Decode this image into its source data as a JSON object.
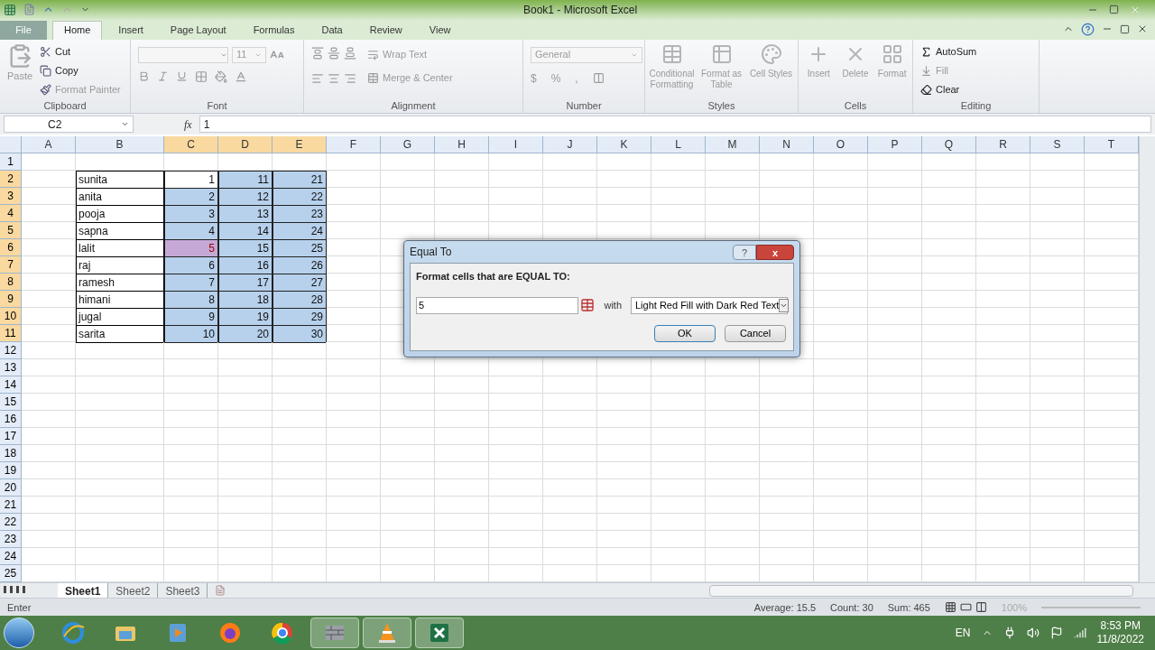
{
  "window": {
    "title": "Book1  -  Microsoft Excel"
  },
  "ribbon_tabs": [
    {
      "label": "File",
      "selected": false,
      "kind": "file"
    },
    {
      "label": "Home",
      "selected": true,
      "kind": "tab"
    },
    {
      "label": "Insert",
      "selected": false,
      "kind": "tab"
    },
    {
      "label": "Page Layout",
      "selected": false,
      "kind": "tab"
    },
    {
      "label": "Formulas",
      "selected": false,
      "kind": "tab"
    },
    {
      "label": "Data",
      "selected": false,
      "kind": "tab"
    },
    {
      "label": "Review",
      "selected": false,
      "kind": "tab"
    },
    {
      "label": "View",
      "selected": false,
      "kind": "tab"
    }
  ],
  "ribbon_groups": [
    {
      "kind": "clipboard",
      "label": "Clipboard",
      "items": [
        {
          "label": "Paste",
          "disabled": true
        },
        {
          "label": "Cut",
          "disabled": false
        },
        {
          "label": "Copy",
          "disabled": false
        },
        {
          "label": "Format Painter",
          "disabled": true
        }
      ]
    },
    {
      "kind": "font",
      "label": "Font",
      "font_size": "11"
    },
    {
      "kind": "alignment",
      "label": "Alignment",
      "items": [
        {
          "label": "Wrap Text",
          "disabled": true
        },
        {
          "label": "Merge & Center",
          "disabled": true
        }
      ]
    },
    {
      "kind": "number",
      "label": "Number",
      "format": "General",
      "symbols": [
        "$",
        "%",
        ","
      ]
    },
    {
      "kind": "styles",
      "label": "Styles",
      "items": [
        {
          "label": "Conditional Formatting",
          "disabled": true
        },
        {
          "label": "Format as Table",
          "disabled": true
        },
        {
          "label": "Cell Styles",
          "disabled": true
        }
      ]
    },
    {
      "kind": "cells",
      "label": "Cells",
      "items": [
        {
          "label": "Insert",
          "disabled": true
        },
        {
          "label": "Delete",
          "disabled": true
        },
        {
          "label": "Format",
          "disabled": true
        }
      ]
    },
    {
      "kind": "editing",
      "label": "Editing",
      "items": [
        {
          "label": "AutoSum",
          "disabled": false
        },
        {
          "label": "Fill",
          "disabled": true
        },
        {
          "label": "Clear",
          "disabled": false
        }
      ]
    }
  ],
  "formula_bar": {
    "name_box": "C2",
    "fx": "fx",
    "formula": "1"
  },
  "columns": [
    {
      "label": "A",
      "selected": false
    },
    {
      "label": "B",
      "selected": false
    },
    {
      "label": "C",
      "selected": true
    },
    {
      "label": "D",
      "selected": true
    },
    {
      "label": "E",
      "selected": true
    },
    {
      "label": "F",
      "selected": false
    },
    {
      "label": "G",
      "selected": false
    },
    {
      "label": "H",
      "selected": false
    },
    {
      "label": "I",
      "selected": false
    },
    {
      "label": "J",
      "selected": false
    },
    {
      "label": "K",
      "selected": false
    },
    {
      "label": "L",
      "selected": false
    },
    {
      "label": "M",
      "selected": false
    },
    {
      "label": "N",
      "selected": false
    },
    {
      "label": "O",
      "selected": false
    },
    {
      "label": "P",
      "selected": false
    },
    {
      "label": "Q",
      "selected": false
    },
    {
      "label": "R",
      "selected": false
    },
    {
      "label": "S",
      "selected": false
    },
    {
      "label": "T",
      "selected": false
    }
  ],
  "rows": [
    {
      "label": "1",
      "selected": false
    },
    {
      "label": "2",
      "selected": true,
      "name": "sunita",
      "values": [
        {
          "text": "1",
          "active": true,
          "highlighted": false
        },
        {
          "text": "11",
          "active": false,
          "highlighted": false
        },
        {
          "text": "21",
          "active": false,
          "highlighted": false
        }
      ]
    },
    {
      "label": "3",
      "selected": true,
      "name": "anita",
      "values": [
        {
          "text": "2",
          "active": false,
          "highlighted": false
        },
        {
          "text": "12",
          "active": false,
          "highlighted": false
        },
        {
          "text": "22",
          "active": false,
          "highlighted": false
        }
      ]
    },
    {
      "label": "4",
      "selected": true,
      "name": "pooja",
      "values": [
        {
          "text": "3",
          "active": false,
          "highlighted": false
        },
        {
          "text": "13",
          "active": false,
          "highlighted": false
        },
        {
          "text": "23",
          "active": false,
          "highlighted": false
        }
      ]
    },
    {
      "label": "5",
      "selected": true,
      "name": "sapna",
      "values": [
        {
          "text": "4",
          "active": false,
          "highlighted": false
        },
        {
          "text": "14",
          "active": false,
          "highlighted": false
        },
        {
          "text": "24",
          "active": false,
          "highlighted": false
        }
      ]
    },
    {
      "label": "6",
      "selected": true,
      "name": "lalit",
      "values": [
        {
          "text": "5",
          "active": false,
          "highlighted": true
        },
        {
          "text": "15",
          "active": false,
          "highlighted": false
        },
        {
          "text": "25",
          "active": false,
          "highlighted": false
        }
      ]
    },
    {
      "label": "7",
      "selected": true,
      "name": "raj",
      "values": [
        {
          "text": "6",
          "active": false,
          "highlighted": false
        },
        {
          "text": "16",
          "active": false,
          "highlighted": false
        },
        {
          "text": "26",
          "active": false,
          "highlighted": false
        }
      ]
    },
    {
      "label": "8",
      "selected": true,
      "name": "ramesh",
      "values": [
        {
          "text": "7",
          "active": false,
          "highlighted": false
        },
        {
          "text": "17",
          "active": false,
          "highlighted": false
        },
        {
          "text": "27",
          "active": false,
          "highlighted": false
        }
      ]
    },
    {
      "label": "9",
      "selected": true,
      "name": "himani",
      "values": [
        {
          "text": "8",
          "active": false,
          "highlighted": false
        },
        {
          "text": "18",
          "active": false,
          "highlighted": false
        },
        {
          "text": "28",
          "active": false,
          "highlighted": false
        }
      ]
    },
    {
      "label": "10",
      "selected": true,
      "name": "jugal",
      "values": [
        {
          "text": "9",
          "active": false,
          "highlighted": false
        },
        {
          "text": "19",
          "active": false,
          "highlighted": false
        },
        {
          "text": "29",
          "active": false,
          "highlighted": false
        }
      ]
    },
    {
      "label": "11",
      "selected": true,
      "name": "sarita",
      "values": [
        {
          "text": "10",
          "active": false,
          "highlighted": false
        },
        {
          "text": "20",
          "active": false,
          "highlighted": false
        },
        {
          "text": "30",
          "active": false,
          "highlighted": false
        }
      ]
    },
    {
      "label": "12",
      "selected": false
    },
    {
      "label": "13",
      "selected": false
    },
    {
      "label": "14",
      "selected": false
    },
    {
      "label": "15",
      "selected": false
    },
    {
      "label": "16",
      "selected": false
    },
    {
      "label": "17",
      "selected": false
    },
    {
      "label": "18",
      "selected": false
    },
    {
      "label": "19",
      "selected": false
    },
    {
      "label": "20",
      "selected": false
    },
    {
      "label": "21",
      "selected": false
    },
    {
      "label": "22",
      "selected": false
    },
    {
      "label": "23",
      "selected": false
    },
    {
      "label": "24",
      "selected": false
    },
    {
      "label": "25",
      "selected": false
    }
  ],
  "sheet_tabs": [
    {
      "label": "Sheet1",
      "selected": true
    },
    {
      "label": "Sheet2",
      "selected": false
    },
    {
      "label": "Sheet3",
      "selected": false
    }
  ],
  "status_bar": {
    "mode": "Enter",
    "average": "Average: 15.5",
    "count": "Count: 30",
    "sum": "Sum: 465",
    "zoom": "100%"
  },
  "dialog": {
    "title": "Equal To",
    "help": "?",
    "close": "x",
    "prompt": "Format cells that are EQUAL TO:",
    "value": "5",
    "with": "with",
    "format": "Light Red Fill with Dark Red Text",
    "buttons": [
      "OK",
      "Cancel"
    ]
  },
  "taskbar": {
    "apps": [
      {
        "running": false
      },
      {
        "running": false
      },
      {
        "running": false
      },
      {
        "running": false
      },
      {
        "running": false
      },
      {
        "running": true
      },
      {
        "running": true
      },
      {
        "running": true
      }
    ],
    "language": "EN",
    "time": "8:53 PM",
    "date": "11/8/2022"
  }
}
